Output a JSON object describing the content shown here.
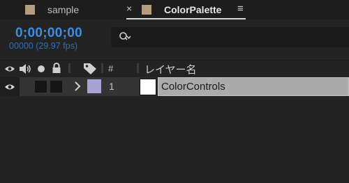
{
  "tabs": [
    {
      "label": "sample"
    },
    {
      "label": "ColorPalette",
      "active": true
    }
  ],
  "tab_close_glyph": "×",
  "tab_menu_glyph": "≡",
  "header": {
    "timecode": "0;00;00;00",
    "frames": "00000 (29.97 fps)",
    "search_icon": "search-dropdown-icon"
  },
  "columns": {
    "hash": "#",
    "layer_name": "レイヤー名"
  },
  "layers": [
    {
      "number": "1",
      "name": "ColorControls",
      "label_color": "#a7a3d2"
    }
  ],
  "colors": {
    "timecode": "#3a8ee6",
    "tab_swatch": "#b49c7c"
  }
}
